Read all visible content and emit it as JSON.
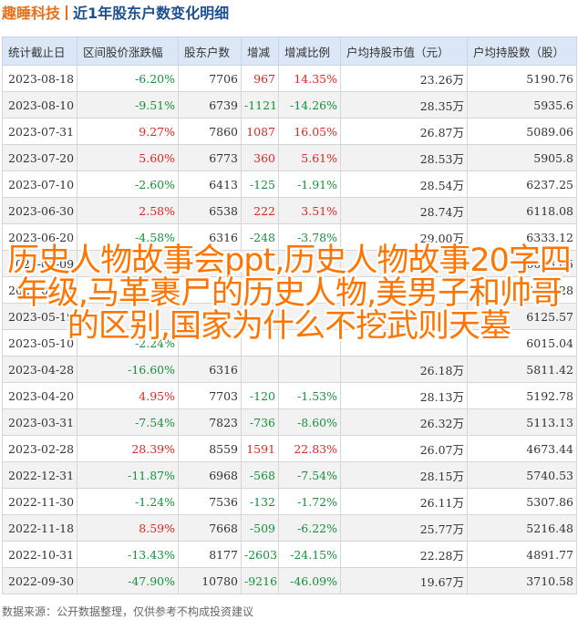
{
  "header": {
    "brand": "趣睡科技",
    "title": "近1年股东户数变化明细"
  },
  "table": {
    "columns": [
      "统计截止日",
      "区间股价涨跌幅",
      "股东户数",
      "增减",
      "增减比例",
      "户均持股市值（元）",
      "户均持股数（股）"
    ],
    "rows": [
      {
        "date": "2023-08-18",
        "pct": "-6.20%",
        "holders": "7706",
        "change": "967",
        "ratio": "14.35%",
        "value": "23.26万",
        "shares": "5190.76"
      },
      {
        "date": "2023-08-10",
        "pct": "-9.51%",
        "holders": "6739",
        "change": "-1121",
        "ratio": "-14.26%",
        "value": "28.35万",
        "shares": "5935.6"
      },
      {
        "date": "2023-07-31",
        "pct": "9.27%",
        "holders": "7860",
        "change": "1087",
        "ratio": "16.05%",
        "value": "26.87万",
        "shares": "5089.06"
      },
      {
        "date": "2023-07-20",
        "pct": "5.60%",
        "holders": "6773",
        "change": "360",
        "ratio": "5.61%",
        "value": "28.53万",
        "shares": "5905.8"
      },
      {
        "date": "2023-07-10",
        "pct": "-2.60%",
        "holders": "6413",
        "change": "-125",
        "ratio": "-1.91%",
        "value": "28.54万",
        "shares": "6237.25"
      },
      {
        "date": "2023-06-30",
        "pct": "2.58%",
        "holders": "6538",
        "change": "222",
        "ratio": "3.51%",
        "value": "28.74万",
        "shares": "6118.08"
      },
      {
        "date": "2023-06-20",
        "pct": "-4.58%",
        "holders": "6316",
        "change": "-248",
        "ratio": "-3.78%",
        "value": "29.00万",
        "shares": "6333.12"
      },
      {
        "date": "2023-06-09",
        "pct": "",
        "holders": "",
        "change": "",
        "ratio": "",
        "value": "",
        "shares": "6093.85"
      },
      {
        "date": "2023-05-31",
        "pct": "",
        "holders": "",
        "change": "",
        "ratio": "",
        "value": "",
        "shares": "6088.28"
      },
      {
        "date": "2023-05-19",
        "pct": "",
        "holders": "",
        "change": "",
        "ratio": "",
        "value": "",
        "shares": "6125.57"
      },
      {
        "date": "2023-05-10",
        "pct": "-2.24%",
        "holders": "",
        "change": "",
        "ratio": "",
        "value": "",
        "shares": "6015.04"
      },
      {
        "date": "2023-04-28",
        "pct": "-16.60%",
        "holders": "6316",
        "change": "",
        "ratio": "",
        "value": "26.18万",
        "shares": "5811.42"
      },
      {
        "date": "2023-04-20",
        "pct": "4.95%",
        "holders": "7703",
        "change": "-120",
        "ratio": "-1.53%",
        "value": "28.13万",
        "shares": "5192.78"
      },
      {
        "date": "2023-03-31",
        "pct": "-7.54%",
        "holders": "7823",
        "change": "-736",
        "ratio": "-8.60%",
        "value": "26.32万",
        "shares": "5113.13"
      },
      {
        "date": "2023-02-28",
        "pct": "28.39%",
        "holders": "8559",
        "change": "1591",
        "ratio": "22.83%",
        "value": "26.07万",
        "shares": "4673.44"
      },
      {
        "date": "2022-12-31",
        "pct": "-11.87%",
        "holders": "6968",
        "change": "-568",
        "ratio": "-7.54%",
        "value": "28.15万",
        "shares": "5740.53"
      },
      {
        "date": "2022-11-30",
        "pct": "-1.24%",
        "holders": "7536",
        "change": "-132",
        "ratio": "-1.72%",
        "value": "26.11万",
        "shares": "5307.86"
      },
      {
        "date": "2022-11-18",
        "pct": "8.59%",
        "holders": "7668",
        "change": "-509",
        "ratio": "-6.22%",
        "value": "25.77万",
        "shares": "5216.48"
      },
      {
        "date": "2022-10-31",
        "pct": "-13.43%",
        "holders": "8177",
        "change": "-2603",
        "ratio": "-24.15%",
        "value": "22.28万",
        "shares": "4891.77"
      },
      {
        "date": "2022-09-30",
        "pct": "-47.90%",
        "holders": "10780",
        "change": "-9216",
        "ratio": "-46.09%",
        "value": "19.67万",
        "shares": "3710.58"
      }
    ]
  },
  "overlay": {
    "text": "历史人物故事会ppt,历史人物故事20字四年级,马革裹尸的历史人物,美男子和帅哥的区别,国家为什么不挖武则天墓"
  },
  "footer": {
    "text": "数据来源：公开数据整理，仅供参考不构成投资建议"
  },
  "colors": {
    "positive": "#e0261f",
    "negative": "#149238",
    "brand": "#e8701a",
    "title": "#1d4f91",
    "overlay": "#ff7500"
  }
}
